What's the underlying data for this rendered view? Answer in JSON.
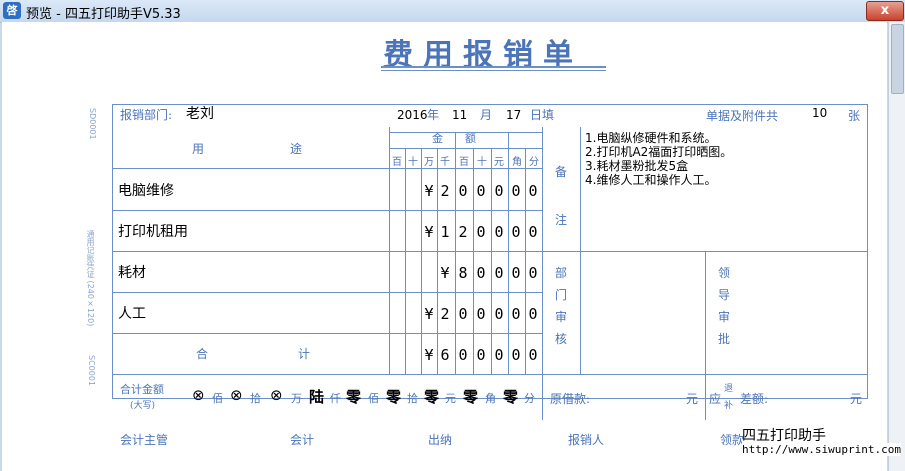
{
  "window": {
    "title": "预览 - 四五打印助手V5.33",
    "icon_text": "啓",
    "close_label": "x"
  },
  "doc": {
    "title": "费用报销单",
    "dept_label": "报销部门:",
    "dept_value": "老刘",
    "year": "2016",
    "year_label": "年",
    "month": "11",
    "month_label": "月",
    "day": "17",
    "day_label": "日填",
    "attach_label": "单据及附件共",
    "attach_count": "10",
    "attach_unit": "张",
    "side_text": "SD0001",
    "side_text2": "通用记账凭证 (240×120)",
    "side_text3": "SC0001"
  },
  "table": {
    "purpose_header": "用　　　　　　途",
    "amount_header": "金　　额",
    "digit_headers": [
      "百",
      "十",
      "万",
      "千",
      "百",
      "十",
      "元",
      "角",
      "分"
    ],
    "rows": [
      {
        "label": "电脑维修",
        "digits": [
          "",
          "",
          "",
          "¥",
          "2",
          "0",
          "0",
          "0",
          "0",
          "0"
        ]
      },
      {
        "label": "打印机租用",
        "digits": [
          "",
          "",
          "",
          "¥",
          "1",
          "2",
          "0",
          "0",
          "0",
          "0"
        ]
      },
      {
        "label": "耗材",
        "digits": [
          "",
          "",
          "",
          "",
          "¥",
          "8",
          "0",
          "0",
          "0",
          "0"
        ]
      },
      {
        "label": "人工",
        "digits": [
          "",
          "",
          "",
          "¥",
          "2",
          "0",
          "0",
          "0",
          "0",
          "0"
        ]
      }
    ],
    "total_label_left": "合",
    "total_label_right": "计",
    "total_digits": [
      "",
      "",
      "",
      "¥",
      "6",
      "0",
      "0",
      "0",
      "0",
      "0"
    ],
    "remark_label": [
      "备",
      "注"
    ],
    "remarks": [
      "1.电脑纵修硬件和系统。",
      "2.打印机A2福面打印晒图。",
      "3.耗材墨粉批发5盒",
      "4.维修人工和操作人工。"
    ],
    "dept_review_label": [
      "部",
      "门",
      "审",
      "核"
    ],
    "leader_review_label": [
      "领",
      "导",
      "审",
      "批"
    ]
  },
  "capital": {
    "label": "合计金额",
    "sublabel": "(大写)",
    "x_marks": [
      "⊗",
      "⊗",
      "⊗"
    ],
    "x_units": [
      "佰",
      "拾",
      "万"
    ],
    "chars": [
      "陆",
      "零",
      "零",
      "零",
      "零",
      "零"
    ],
    "units": [
      "仟",
      "佰",
      "拾",
      "元",
      "角",
      "分"
    ],
    "borrow_label": "原借款:",
    "borrow_unit": "元",
    "refund_label": "应",
    "refund_sub": "退",
    "refund_sub2": "补",
    "diff_label": "差额:",
    "diff_unit": "元"
  },
  "footer": {
    "accountant_mgr": "会计主管",
    "accountant": "会计",
    "cashier": "出纳",
    "claimant": "报销人",
    "receiver": "领款",
    "watermark": "四五打印助手",
    "watermark_url": "http://www.siwuprint.com"
  }
}
